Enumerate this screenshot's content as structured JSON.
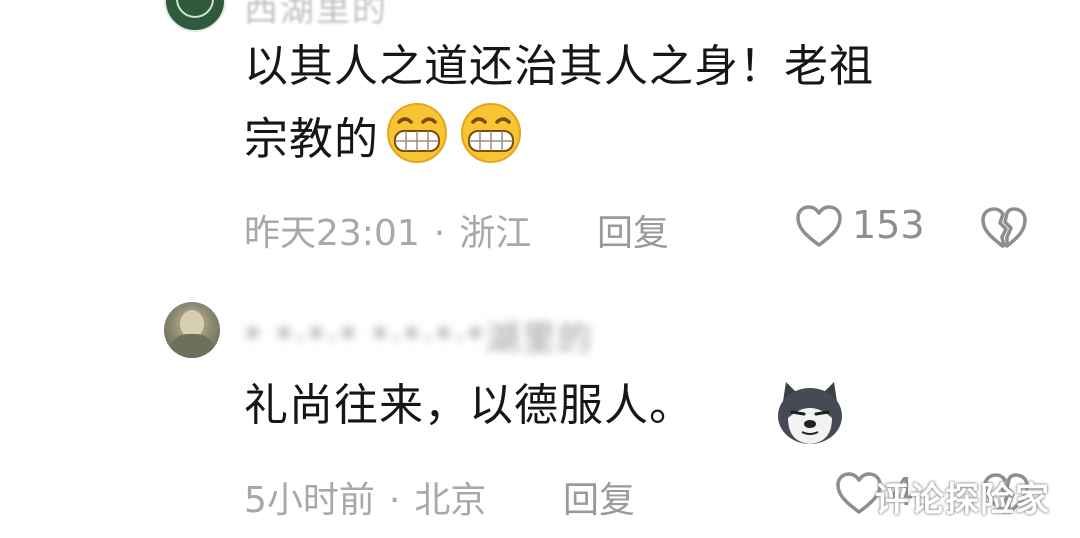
{
  "comments": [
    {
      "user_name": "西湖里的",
      "text_line1": "以其人之道还治其人之身！老祖",
      "text_line2": "宗教的",
      "emoji": [
        "grin-emoji",
        "grin-emoji"
      ],
      "time": "昨天23:01",
      "location": "浙江",
      "reply_label": "回复",
      "likes": "153"
    },
    {
      "user_name": "*  *·*·* *·*·*·*湖里的",
      "text": "礼尚往来，以德服人。",
      "emoji": [
        "dog-emoji"
      ],
      "time": "5小时前",
      "location": "北京",
      "reply_label": "回复",
      "likes": "4"
    }
  ],
  "separator": "·",
  "watermark": "评论探险家",
  "icons": {
    "like": "heart-outline-icon",
    "dislike": "broken-heart-icon"
  },
  "colors": {
    "text": "#161616",
    "meta": "#a8a8a8",
    "icon": "#8e8e8e"
  }
}
